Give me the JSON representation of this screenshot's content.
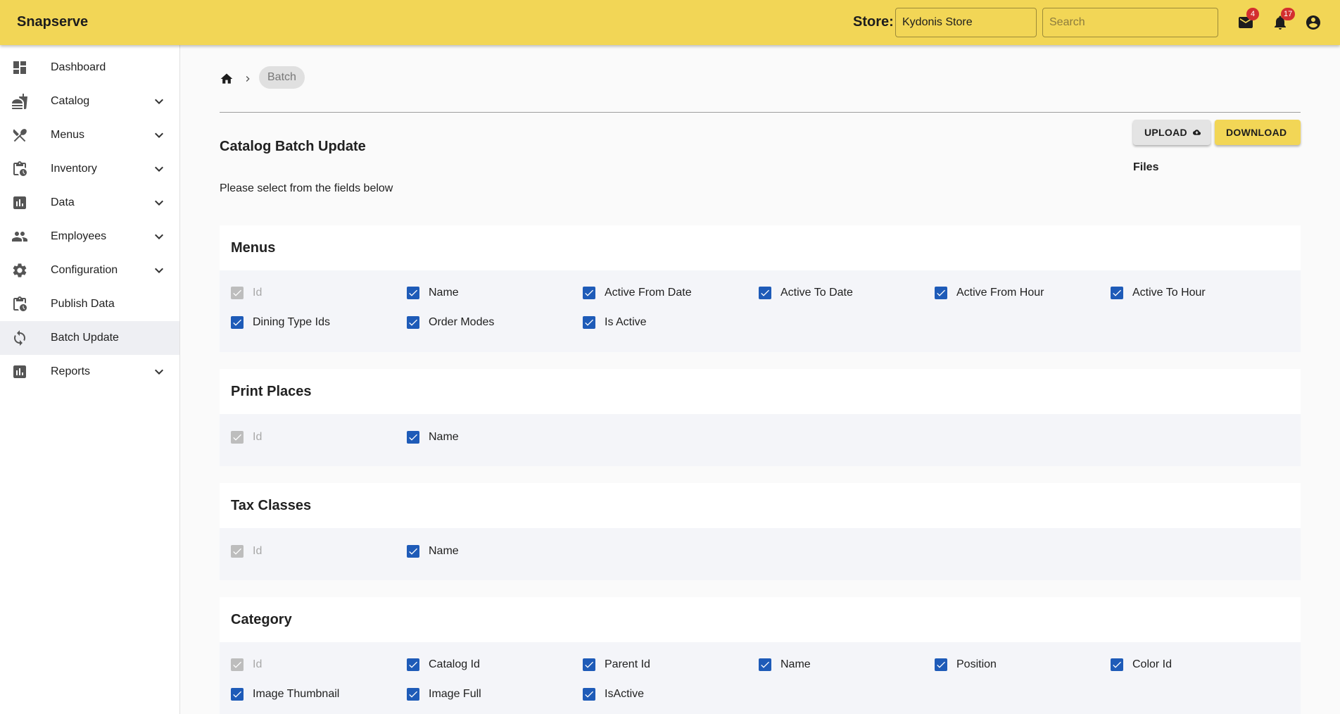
{
  "app": {
    "brand": "Snapserve",
    "store_label": "Store:",
    "store_value": "Kydonis Store",
    "search_placeholder": "Search",
    "mail_count": "4",
    "notif_count": "17"
  },
  "sidebar": {
    "items": [
      {
        "label": "Dashboard",
        "icon": "dashboard-icon",
        "has_chevron": false
      },
      {
        "label": "Catalog",
        "icon": "catalog-icon",
        "has_chevron": true
      },
      {
        "label": "Menus",
        "icon": "menus-icon",
        "has_chevron": true
      },
      {
        "label": "Inventory",
        "icon": "inventory-icon",
        "has_chevron": true
      },
      {
        "label": "Data",
        "icon": "data-icon",
        "has_chevron": true
      },
      {
        "label": "Employees",
        "icon": "employees-icon",
        "has_chevron": true
      },
      {
        "label": "Configuration",
        "icon": "gear-icon",
        "has_chevron": true
      },
      {
        "label": "Publish Data",
        "icon": "publish-icon",
        "has_chevron": false
      },
      {
        "label": "Batch Update",
        "icon": "sync-icon",
        "has_chevron": false,
        "active": true
      },
      {
        "label": "Reports",
        "icon": "reports-icon",
        "has_chevron": true
      }
    ]
  },
  "breadcrumb": {
    "current": "Batch"
  },
  "page": {
    "title": "Catalog Batch Update",
    "subtitle": "Please select from the fields below",
    "upload_label": "UPLOAD",
    "download_label": "DOWNLOAD",
    "files_label": "Files"
  },
  "sections": [
    {
      "title": "Menus",
      "fields": [
        {
          "label": "Id",
          "checked": true,
          "disabled": true
        },
        {
          "label": "Name",
          "checked": true,
          "disabled": false
        },
        {
          "label": "Active From Date",
          "checked": true,
          "disabled": false
        },
        {
          "label": "Active To Date",
          "checked": true,
          "disabled": false
        },
        {
          "label": "Active From Hour",
          "checked": true,
          "disabled": false
        },
        {
          "label": "Active To Hour",
          "checked": true,
          "disabled": false
        },
        {
          "label": "Dining Type Ids",
          "checked": true,
          "disabled": false
        },
        {
          "label": "Order Modes",
          "checked": true,
          "disabled": false
        },
        {
          "label": "Is Active",
          "checked": true,
          "disabled": false
        }
      ]
    },
    {
      "title": "Print Places",
      "fields": [
        {
          "label": "Id",
          "checked": true,
          "disabled": true
        },
        {
          "label": "Name",
          "checked": true,
          "disabled": false
        }
      ]
    },
    {
      "title": "Tax Classes",
      "fields": [
        {
          "label": "Id",
          "checked": true,
          "disabled": true
        },
        {
          "label": "Name",
          "checked": true,
          "disabled": false
        }
      ]
    },
    {
      "title": "Category",
      "fields": [
        {
          "label": "Id",
          "checked": true,
          "disabled": true
        },
        {
          "label": "Catalog Id",
          "checked": true,
          "disabled": false
        },
        {
          "label": "Parent Id",
          "checked": true,
          "disabled": false
        },
        {
          "label": "Name",
          "checked": true,
          "disabled": false
        },
        {
          "label": "Position",
          "checked": true,
          "disabled": false
        },
        {
          "label": "Color Id",
          "checked": true,
          "disabled": false
        },
        {
          "label": "Image Thumbnail",
          "checked": true,
          "disabled": false
        },
        {
          "label": "Image Full",
          "checked": true,
          "disabled": false
        },
        {
          "label": "IsActive",
          "checked": true,
          "disabled": false
        }
      ]
    }
  ],
  "colors": {
    "header_bg": "#f2d656",
    "checkbox": "#1e5bb8",
    "badge": "#d32f2f"
  }
}
